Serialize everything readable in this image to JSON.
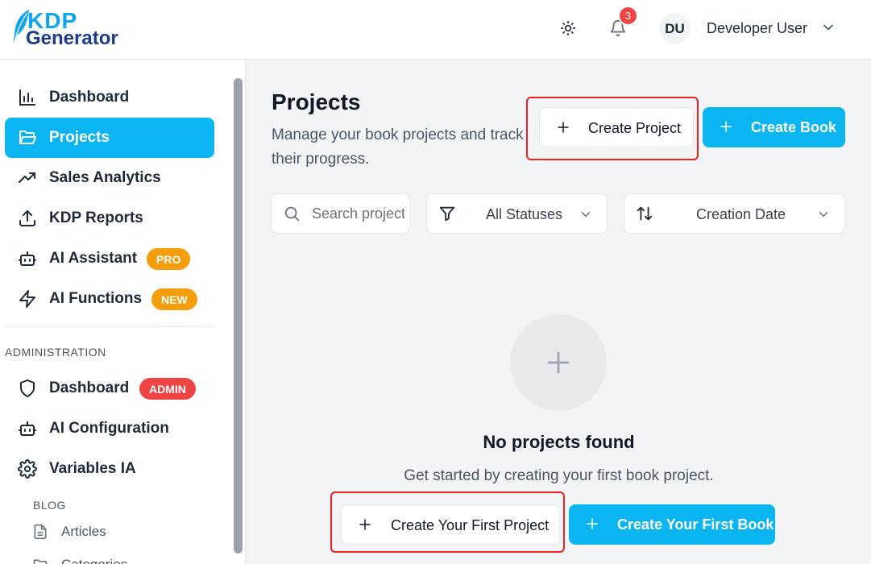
{
  "brand": {
    "line1": "KDP",
    "line2": "Generator"
  },
  "header": {
    "notification_count": "3",
    "user_initials": "DU",
    "user_name": "Developer User"
  },
  "sidebar": {
    "items": [
      {
        "label": "Dashboard",
        "icon": "bar-chart-icon"
      },
      {
        "label": "Projects",
        "icon": "folder-icon",
        "active": true
      },
      {
        "label": "Sales Analytics",
        "icon": "trending-up-icon"
      },
      {
        "label": "KDP Reports",
        "icon": "upload-icon"
      },
      {
        "label": "AI Assistant",
        "icon": "bot-icon",
        "badge": "PRO"
      },
      {
        "label": "AI Functions",
        "icon": "zap-icon",
        "badge": "NEW"
      }
    ],
    "admin_section_title": "ADMINISTRATION",
    "admin_items": [
      {
        "label": "Dashboard",
        "icon": "shield-icon",
        "badge": "ADMIN"
      },
      {
        "label": "AI Configuration",
        "icon": "bot-icon"
      },
      {
        "label": "Variables IA",
        "icon": "gear-icon"
      }
    ],
    "blog_title": "BLOG",
    "blog_items": [
      {
        "label": "Articles",
        "icon": "document-icon"
      },
      {
        "label": "Categories",
        "icon": "folder-icon"
      }
    ]
  },
  "main": {
    "title": "Projects",
    "subtitle": "Manage your book projects and track their progress.",
    "create_project_label": "Create Project",
    "create_book_label": "Create Book",
    "search_placeholder": "Search projects...",
    "status_filter_value": "All Statuses",
    "sort_value": "Creation Date",
    "empty_title": "No projects found",
    "empty_subtitle": "Get started by creating your first book project.",
    "create_first_project_label": "Create Your First Project",
    "create_first_book_label": "Create Your First Book"
  },
  "colors": {
    "accent": "#0ab5f0",
    "pro_badge": "#f59e0b",
    "admin_badge": "#ef4444",
    "highlight_box": "#ef2020"
  }
}
